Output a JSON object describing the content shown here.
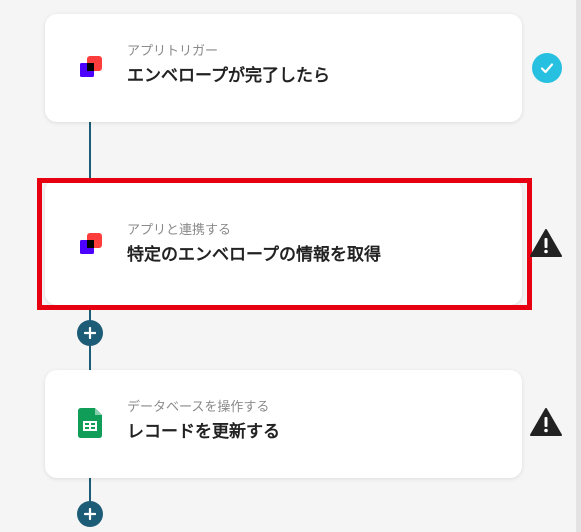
{
  "colors": {
    "connector": "#1d5c77",
    "check": "#27c0e0",
    "warning": "#222222",
    "highlight": "#e60012",
    "docusign_red": "#ff3c3c",
    "docusign_purple": "#4c00ff",
    "sheets_green": "#0f9d58"
  },
  "flow": {
    "steps": [
      {
        "category": "アプリトリガー",
        "title": "エンベロープが完了したら",
        "icon": "docusign-icon",
        "status": "check-icon"
      },
      {
        "category": "アプリと連携する",
        "title": "特定のエンベロープの情報を取得",
        "icon": "docusign-icon",
        "status": "warning-icon",
        "highlighted": true
      },
      {
        "category": "データベースを操作する",
        "title": "レコードを更新する",
        "icon": "google-sheets-icon",
        "status": "warning-icon"
      }
    ],
    "add_button_icon": "plus-icon"
  }
}
